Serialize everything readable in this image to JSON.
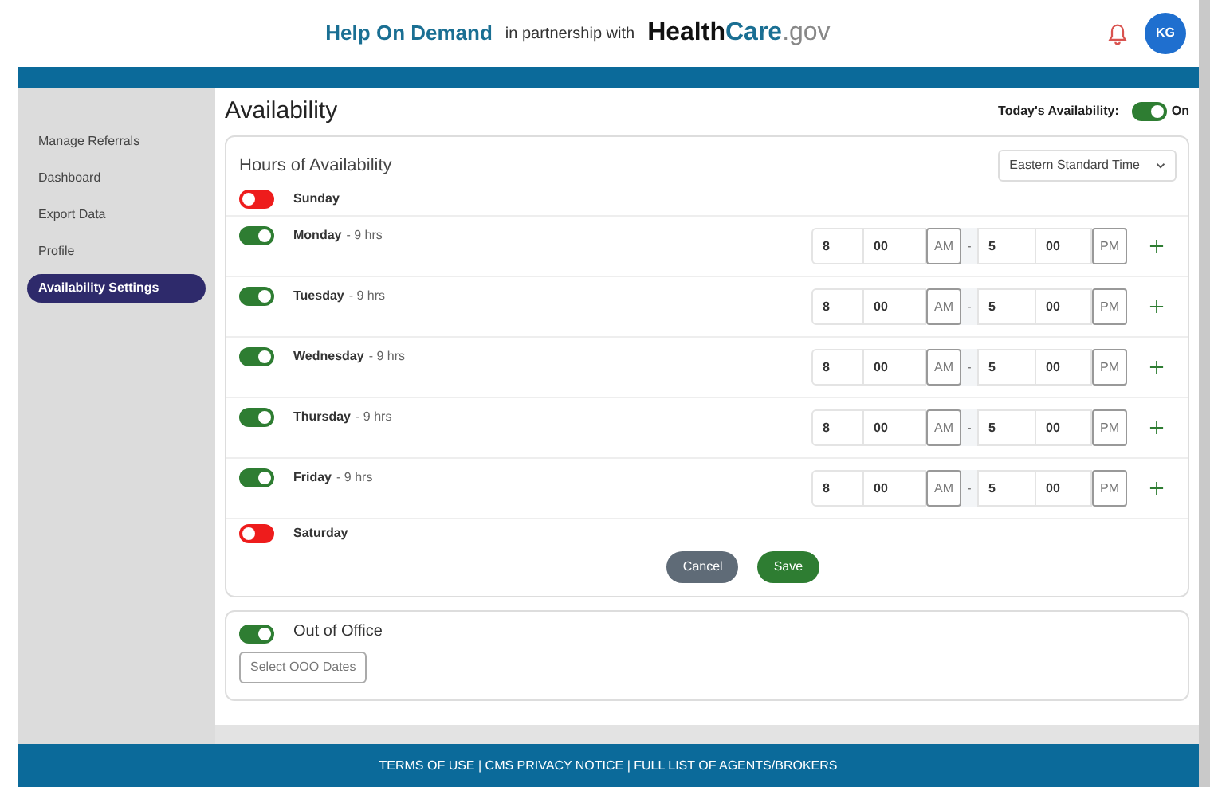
{
  "header": {
    "brand": "Help On Demand",
    "partner_text": "in partnership with",
    "partner_logo": [
      {
        "text": "Health",
        "kind": "strong"
      },
      {
        "text": "Care",
        "kind": "accent"
      },
      {
        "text": ".gov",
        "kind": "light"
      }
    ],
    "avatar": "KG"
  },
  "sidebar": {
    "items": [
      {
        "label": "Manage Referrals",
        "selected": false
      },
      {
        "label": "Dashboard",
        "selected": false
      },
      {
        "label": "Export Data",
        "selected": false
      },
      {
        "label": "Profile",
        "selected": false
      },
      {
        "label": "Availability Settings",
        "selected": true
      }
    ]
  },
  "page": {
    "title": "Availability",
    "today_label": "Today's Availability:",
    "today_on": true,
    "today_text": "On"
  },
  "hours": {
    "title": "Hours of Availability",
    "timezone": "Eastern Standard Time",
    "days": [
      {
        "name": "Sunday",
        "on": false
      },
      {
        "name": "Monday",
        "on": true,
        "duration": "- 9 hrs",
        "start_hour": "8",
        "start_min": "00",
        "start_ampm": "AM",
        "separator": "-",
        "end_hour": "5",
        "end_min": "00",
        "end_ampm": "PM"
      },
      {
        "name": "Tuesday",
        "on": true,
        "duration": "- 9 hrs",
        "start_hour": "8",
        "start_min": "00",
        "start_ampm": "AM",
        "separator": "-",
        "end_hour": "5",
        "end_min": "00",
        "end_ampm": "PM"
      },
      {
        "name": "Wednesday",
        "on": true,
        "duration": "- 9 hrs",
        "start_hour": "8",
        "start_min": "00",
        "start_ampm": "AM",
        "separator": "-",
        "end_hour": "5",
        "end_min": "00",
        "end_ampm": "PM"
      },
      {
        "name": "Thursday",
        "on": true,
        "duration": "- 9 hrs",
        "start_hour": "8",
        "start_min": "00",
        "start_ampm": "AM",
        "separator": "-",
        "end_hour": "5",
        "end_min": "00",
        "end_ampm": "PM"
      },
      {
        "name": "Friday",
        "on": true,
        "duration": "- 9 hrs",
        "start_hour": "8",
        "start_min": "00",
        "start_ampm": "AM",
        "separator": "-",
        "end_hour": "5",
        "end_min": "00",
        "end_ampm": "PM"
      },
      {
        "name": "Saturday",
        "on": false
      }
    ],
    "buttons": [
      {
        "label": "Cancel",
        "kind": "secondary"
      },
      {
        "label": "Save",
        "kind": "primary"
      }
    ]
  },
  "out_of_office": {
    "title": "Out of Office",
    "on": true,
    "button": "Select OOO Dates"
  },
  "footer": "TERMS OF USE | CMS PRIVACY NOTICE | FULL LIST OF AGENTS/BROKERS"
}
